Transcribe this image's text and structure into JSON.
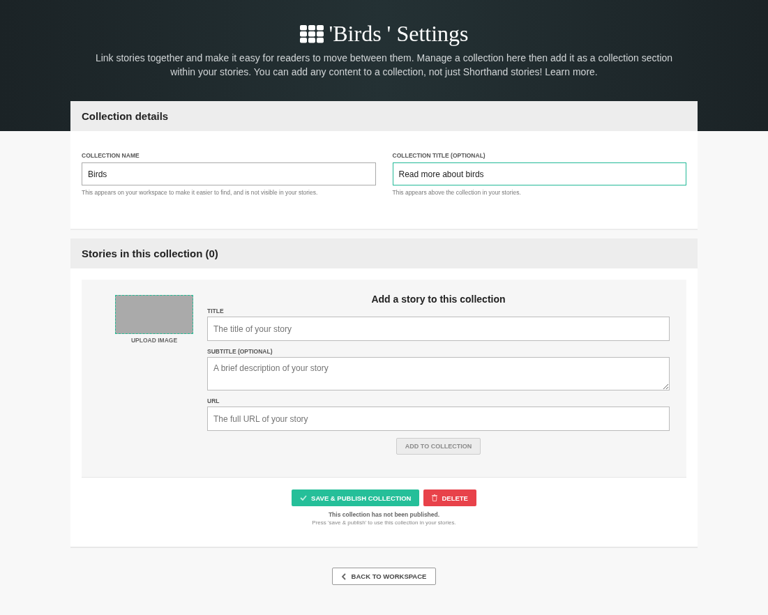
{
  "header": {
    "title": "'Birds ' Settings",
    "description": "Link stories together and make it easy for readers to move between them. Manage a collection here then add it as a collection section within your stories. You can add any content to a collection, not just Shorthand stories! Learn more."
  },
  "details": {
    "heading": "Collection details",
    "fields": [
      {
        "label": "COLLECTION NAME",
        "value": "Birds",
        "help": "This appears on your workspace to make it easier to find, and is not visible in your stories.",
        "focused": false
      },
      {
        "label": "COLLECTION TITLE (OPTIONAL)",
        "value": "Read more about birds",
        "help": "This appears above the collection in your stories.",
        "focused": true
      }
    ]
  },
  "stories": {
    "heading": "Stories in this collection (0)",
    "add_heading": "Add a story to this collection",
    "upload_label": "UPLOAD IMAGE",
    "fields": [
      {
        "label": "TITLE",
        "placeholder": "The title of your story",
        "kind": "input"
      },
      {
        "label": "SUBTITLE (OPTIONAL)",
        "placeholder": "A brief description of your story",
        "kind": "textarea"
      },
      {
        "label": "URL",
        "placeholder": "The full URL of your story",
        "kind": "input"
      }
    ],
    "add_button": {
      "label": "ADD TO COLLECTION",
      "disabled": true
    }
  },
  "actions": {
    "save": "SAVE & PUBLISH COLLECTION",
    "delete": "DELETE",
    "status": "This collection has not been published.",
    "hint": "Press 'save & publish' to use this collection in your stories."
  },
  "back": "BACK TO WORKSPACE"
}
